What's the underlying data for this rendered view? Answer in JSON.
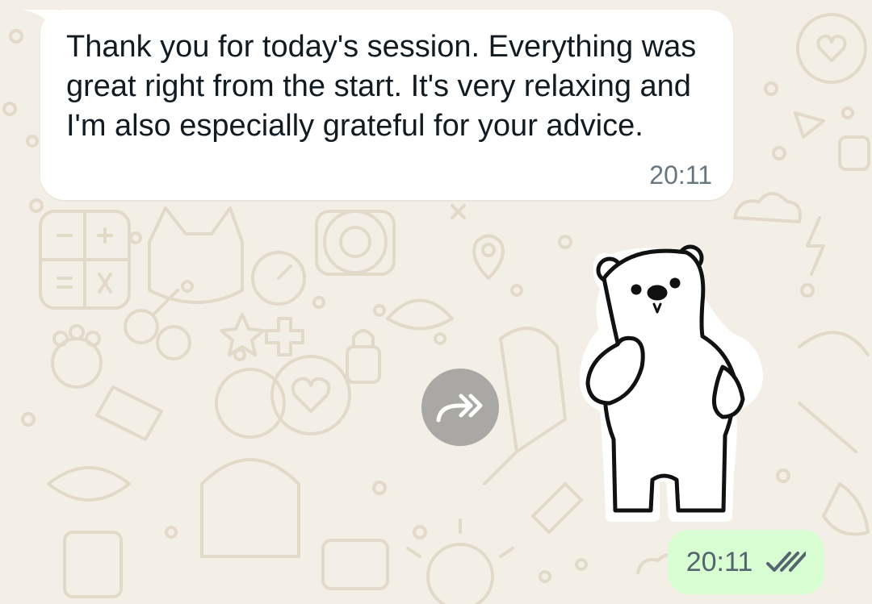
{
  "chat": {
    "incoming_message": {
      "text": "Thank you for today's session. Everything was great right from the start. It's very relaxing and I'm also especially grateful for your advice.",
      "time": "20:11"
    },
    "forward_button": {
      "icon": "forward-arrows-icon"
    },
    "sticker": {
      "icon": "polar-bear-sticker"
    },
    "outgoing_message": {
      "time": "20:11",
      "status_icon": "double-check-icon"
    }
  },
  "colors": {
    "wallpaper": "#f4efe6",
    "doodle": "#e3d9c8",
    "incoming_bubble": "#ffffff",
    "outgoing_bubble": "#d9fdd3",
    "text": "#111b21",
    "timestamp": "#667781"
  }
}
